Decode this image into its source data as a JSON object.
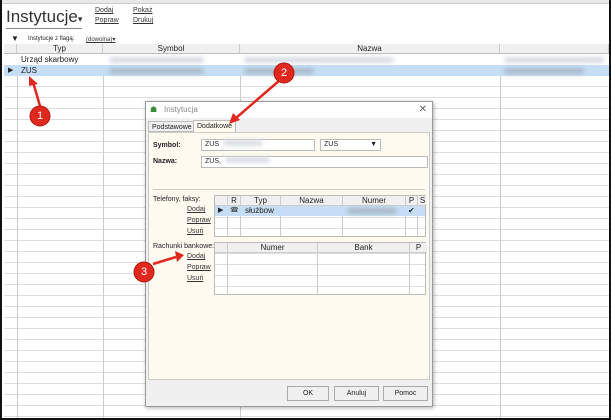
{
  "header": {
    "title": "Instytucje",
    "actions": [
      "Dodaj",
      "Popraw",
      "Pokaż",
      "Drukuj"
    ]
  },
  "filter": {
    "label": "Instytucje z flagą:",
    "value": "(dowolna)"
  },
  "grid": {
    "columns": [
      "Typ",
      "Symbol",
      "Nazwa"
    ],
    "rows": [
      {
        "typ": "Urząd skarbowy"
      },
      {
        "typ": "ZUS"
      }
    ]
  },
  "dialog": {
    "title": "Instytucja",
    "tabs": [
      "Podstawowe",
      "Dodatkowe"
    ],
    "symbol_label": "Symbol:",
    "symbol_value": "ZUS",
    "symbol_type": "ZUS",
    "nazwa_label": "Nazwa:",
    "nazwa_value": "ZUS,",
    "phones": {
      "label": "Telefony, faksy:",
      "links": [
        "Dodaj",
        "Popraw",
        "Usuń"
      ],
      "columns": [
        "R",
        "Typ",
        "Nazwa",
        "Numer",
        "P",
        "S"
      ],
      "row": {
        "typ": "służbow",
        "p": "✔"
      }
    },
    "accounts": {
      "label": "Rachunki bankowe:",
      "links": [
        "Dodaj",
        "Popraw",
        "Usuń"
      ],
      "columns": [
        "Numer",
        "Bank",
        "P"
      ]
    },
    "buttons": [
      "OK",
      "Anuluj",
      "Pomoc"
    ]
  },
  "annotations": [
    "1",
    "2",
    "3"
  ],
  "colors": {
    "selected": "#c5def5",
    "annotation": "#e0281e"
  }
}
